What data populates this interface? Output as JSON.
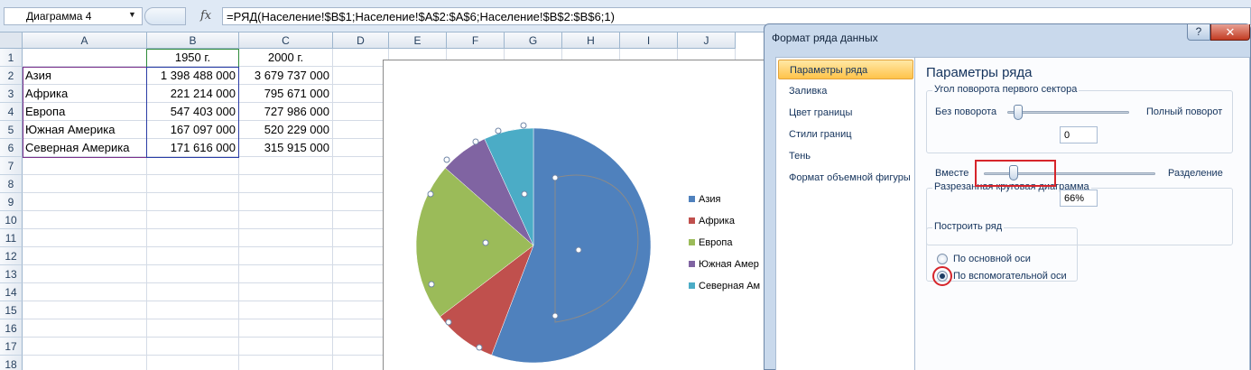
{
  "formula_bar": {
    "name_box": "Диаграмма 4",
    "fx": "fx",
    "formula": "=РЯД(Население!$B$1;Население!$A$2:$A$6;Население!$B$2:$B$6;1)"
  },
  "sheet": {
    "columns": [
      "A",
      "B",
      "C",
      "D",
      "E",
      "F",
      "G",
      "H",
      "I",
      "J"
    ],
    "rows": [
      "1",
      "2",
      "3",
      "4",
      "5",
      "6",
      "7",
      "8",
      "9",
      "10",
      "11",
      "12",
      "13",
      "14",
      "15",
      "16",
      "17",
      "18"
    ],
    "header": [
      "",
      "1950 г.",
      "2000 г."
    ],
    "data": [
      {
        "region": "Азия",
        "y1950": "1 398 488 000",
        "y2000": "3 679 737 000"
      },
      {
        "region": "Африка",
        "y1950": "221 214 000",
        "y2000": "795 671 000"
      },
      {
        "region": "Европа",
        "y1950": "547 403 000",
        "y2000": "727 986 000"
      },
      {
        "region": "Южная Америка",
        "y1950": "167 097 000",
        "y2000": "520 229 000"
      },
      {
        "region": "Северная Америка",
        "y1950": "171 616 000",
        "y2000": "315 915 000"
      }
    ]
  },
  "chart_data": {
    "type": "pie",
    "categories": [
      "Азия",
      "Африка",
      "Европа",
      "Южная Америка",
      "Северная Америка"
    ],
    "values": [
      1398488000,
      221214000,
      547403000,
      167097000,
      171616000
    ],
    "legend_labels": [
      "Азия",
      "Африка",
      "Европа",
      "Южная Амер",
      "Северная Ам"
    ],
    "colors": [
      "#4f81bd",
      "#c0504d",
      "#9bbb59",
      "#8064a2",
      "#4bacc6"
    ],
    "title": "",
    "legend": "right"
  },
  "dialog": {
    "title": "Формат ряда данных",
    "help": "?",
    "close": "✕",
    "nav": [
      "Параметры ряда",
      "Заливка",
      "Цвет границы",
      "Стили границ",
      "Тень",
      "Формат объемной фигуры"
    ],
    "panel_title": "Параметры ряда",
    "rotation": {
      "label": "Угол поворота первого сектора",
      "left": "Без поворота",
      "right": "Полный поворот",
      "value": "0"
    },
    "explosion": {
      "label": "Разрезанная круговая диаграмма",
      "left": "Вместе",
      "right": "Разделение",
      "value": "66%",
      "level": 0.06
    },
    "axis": {
      "label": "Построить ряд",
      "primary": "По основной оси",
      "secondary": "По вспомогательной оси",
      "selected": "secondary"
    },
    "accent_color": "#d6252b"
  }
}
